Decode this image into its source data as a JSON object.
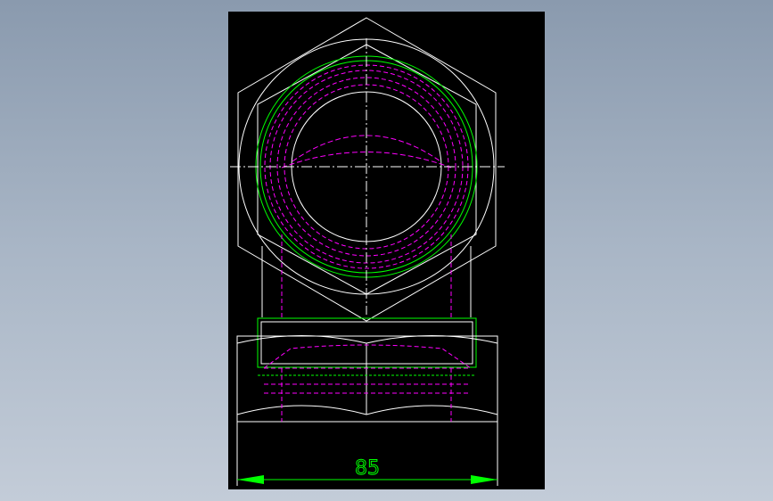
{
  "viewer": {
    "background_colors": [
      "#8a9aae",
      "#c3ccd8"
    ],
    "sheet_color": "#000000"
  },
  "drawing": {
    "colors": {
      "outline": "#ffffff",
      "hidden": "#ff00ff",
      "thread": "#00ff00",
      "dimension": "#00ff00"
    },
    "dimension": {
      "label": "85"
    }
  }
}
